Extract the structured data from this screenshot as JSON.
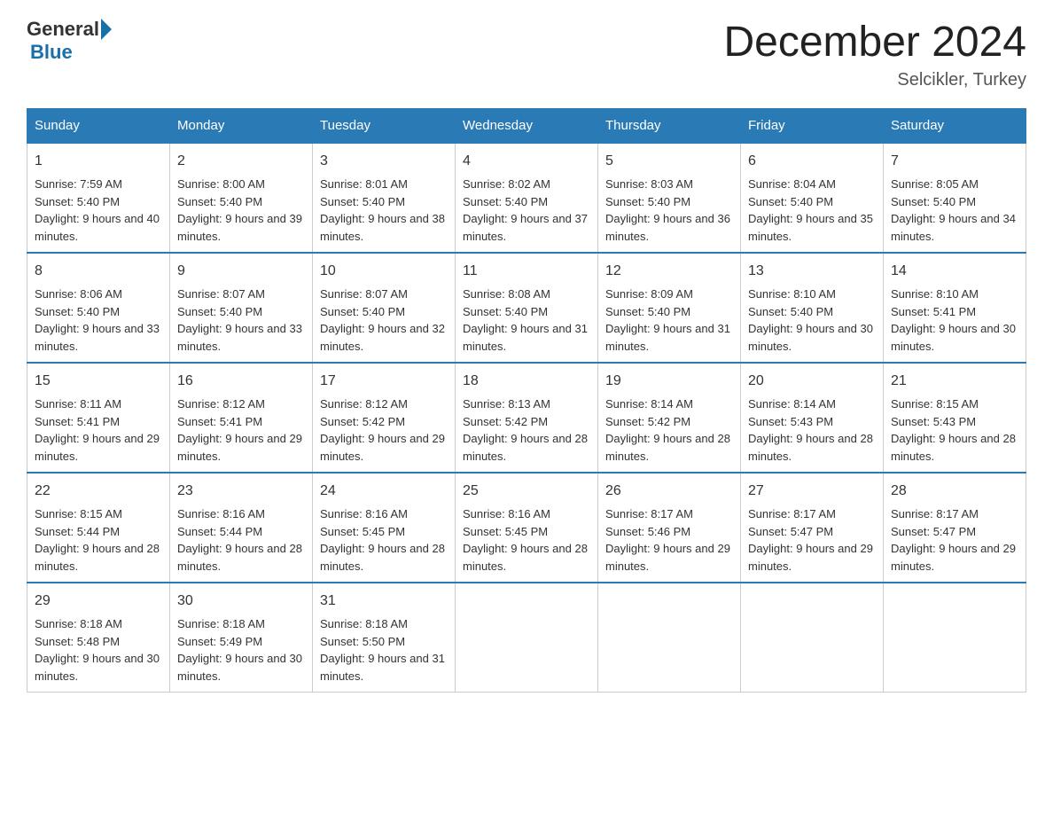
{
  "header": {
    "logo_general": "General",
    "logo_blue": "Blue",
    "month_title": "December 2024",
    "location": "Selcikler, Turkey"
  },
  "days_of_week": [
    "Sunday",
    "Monday",
    "Tuesday",
    "Wednesday",
    "Thursday",
    "Friday",
    "Saturday"
  ],
  "weeks": [
    [
      {
        "day": "1",
        "sunrise": "7:59 AM",
        "sunset": "5:40 PM",
        "daylight": "9 hours and 40 minutes."
      },
      {
        "day": "2",
        "sunrise": "8:00 AM",
        "sunset": "5:40 PM",
        "daylight": "9 hours and 39 minutes."
      },
      {
        "day": "3",
        "sunrise": "8:01 AM",
        "sunset": "5:40 PM",
        "daylight": "9 hours and 38 minutes."
      },
      {
        "day": "4",
        "sunrise": "8:02 AM",
        "sunset": "5:40 PM",
        "daylight": "9 hours and 37 minutes."
      },
      {
        "day": "5",
        "sunrise": "8:03 AM",
        "sunset": "5:40 PM",
        "daylight": "9 hours and 36 minutes."
      },
      {
        "day": "6",
        "sunrise": "8:04 AM",
        "sunset": "5:40 PM",
        "daylight": "9 hours and 35 minutes."
      },
      {
        "day": "7",
        "sunrise": "8:05 AM",
        "sunset": "5:40 PM",
        "daylight": "9 hours and 34 minutes."
      }
    ],
    [
      {
        "day": "8",
        "sunrise": "8:06 AM",
        "sunset": "5:40 PM",
        "daylight": "9 hours and 33 minutes."
      },
      {
        "day": "9",
        "sunrise": "8:07 AM",
        "sunset": "5:40 PM",
        "daylight": "9 hours and 33 minutes."
      },
      {
        "day": "10",
        "sunrise": "8:07 AM",
        "sunset": "5:40 PM",
        "daylight": "9 hours and 32 minutes."
      },
      {
        "day": "11",
        "sunrise": "8:08 AM",
        "sunset": "5:40 PM",
        "daylight": "9 hours and 31 minutes."
      },
      {
        "day": "12",
        "sunrise": "8:09 AM",
        "sunset": "5:40 PM",
        "daylight": "9 hours and 31 minutes."
      },
      {
        "day": "13",
        "sunrise": "8:10 AM",
        "sunset": "5:40 PM",
        "daylight": "9 hours and 30 minutes."
      },
      {
        "day": "14",
        "sunrise": "8:10 AM",
        "sunset": "5:41 PM",
        "daylight": "9 hours and 30 minutes."
      }
    ],
    [
      {
        "day": "15",
        "sunrise": "8:11 AM",
        "sunset": "5:41 PM",
        "daylight": "9 hours and 29 minutes."
      },
      {
        "day": "16",
        "sunrise": "8:12 AM",
        "sunset": "5:41 PM",
        "daylight": "9 hours and 29 minutes."
      },
      {
        "day": "17",
        "sunrise": "8:12 AM",
        "sunset": "5:42 PM",
        "daylight": "9 hours and 29 minutes."
      },
      {
        "day": "18",
        "sunrise": "8:13 AM",
        "sunset": "5:42 PM",
        "daylight": "9 hours and 28 minutes."
      },
      {
        "day": "19",
        "sunrise": "8:14 AM",
        "sunset": "5:42 PM",
        "daylight": "9 hours and 28 minutes."
      },
      {
        "day": "20",
        "sunrise": "8:14 AM",
        "sunset": "5:43 PM",
        "daylight": "9 hours and 28 minutes."
      },
      {
        "day": "21",
        "sunrise": "8:15 AM",
        "sunset": "5:43 PM",
        "daylight": "9 hours and 28 minutes."
      }
    ],
    [
      {
        "day": "22",
        "sunrise": "8:15 AM",
        "sunset": "5:44 PM",
        "daylight": "9 hours and 28 minutes."
      },
      {
        "day": "23",
        "sunrise": "8:16 AM",
        "sunset": "5:44 PM",
        "daylight": "9 hours and 28 minutes."
      },
      {
        "day": "24",
        "sunrise": "8:16 AM",
        "sunset": "5:45 PM",
        "daylight": "9 hours and 28 minutes."
      },
      {
        "day": "25",
        "sunrise": "8:16 AM",
        "sunset": "5:45 PM",
        "daylight": "9 hours and 28 minutes."
      },
      {
        "day": "26",
        "sunrise": "8:17 AM",
        "sunset": "5:46 PM",
        "daylight": "9 hours and 29 minutes."
      },
      {
        "day": "27",
        "sunrise": "8:17 AM",
        "sunset": "5:47 PM",
        "daylight": "9 hours and 29 minutes."
      },
      {
        "day": "28",
        "sunrise": "8:17 AM",
        "sunset": "5:47 PM",
        "daylight": "9 hours and 29 minutes."
      }
    ],
    [
      {
        "day": "29",
        "sunrise": "8:18 AM",
        "sunset": "5:48 PM",
        "daylight": "9 hours and 30 minutes."
      },
      {
        "day": "30",
        "sunrise": "8:18 AM",
        "sunset": "5:49 PM",
        "daylight": "9 hours and 30 minutes."
      },
      {
        "day": "31",
        "sunrise": "8:18 AM",
        "sunset": "5:50 PM",
        "daylight": "9 hours and 31 minutes."
      },
      null,
      null,
      null,
      null
    ]
  ]
}
